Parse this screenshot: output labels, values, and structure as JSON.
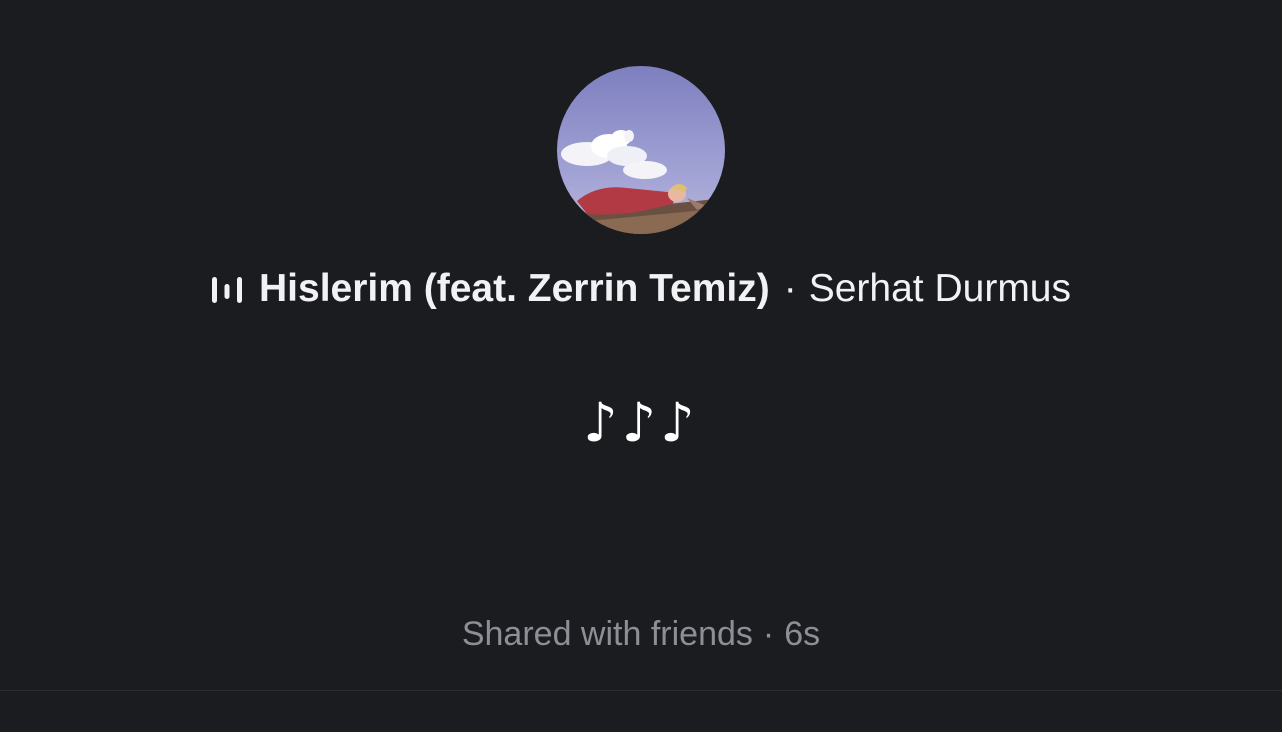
{
  "story": {
    "album_art_icon": "album-cover-sky-clouds-person",
    "now_playing_icon": "equalizer-bars-icon",
    "track_title": "Hislerim (feat. Zerrin Temiz)",
    "separator": "·",
    "artist": "Serhat Durmus",
    "notes_text": "♪♪♪",
    "audience": "Shared with friends",
    "footer_separator": "·",
    "elapsed": "6s"
  },
  "colors": {
    "background": "#1b1c20",
    "primary_text": "#f2f2f4",
    "secondary_text": "#8e8f96"
  }
}
